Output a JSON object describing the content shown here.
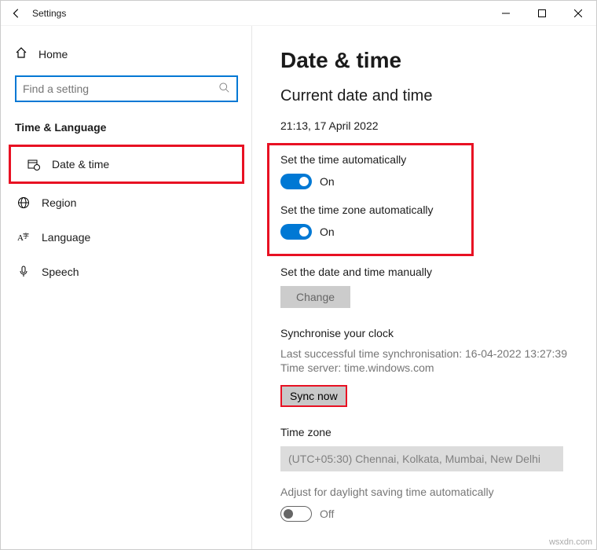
{
  "titlebar": {
    "title": "Settings"
  },
  "sidebar": {
    "home": "Home",
    "search_placeholder": "Find a setting",
    "category": "Time & Language",
    "items": [
      {
        "label": "Date & time"
      },
      {
        "label": "Region"
      },
      {
        "label": "Language"
      },
      {
        "label": "Speech"
      }
    ]
  },
  "content": {
    "heading": "Date & time",
    "subheading": "Current date and time",
    "current_time": "21:13, 17 April 2022",
    "auto_time_label": "Set the time automatically",
    "auto_time_state": "On",
    "auto_tz_label": "Set the time zone automatically",
    "auto_tz_state": "On",
    "manual_label": "Set the date and time manually",
    "change_btn": "Change",
    "sync_heading": "Synchronise your clock",
    "sync_last": "Last successful time synchronisation: 16-04-2022 13:27:39",
    "sync_server": "Time server: time.windows.com",
    "sync_btn": "Sync now",
    "tz_heading": "Time zone",
    "tz_value": "(UTC+05:30) Chennai, Kolkata, Mumbai, New Delhi",
    "dst_label": "Adjust for daylight saving time automatically",
    "dst_state": "Off"
  },
  "watermark": "wsxdn.com"
}
